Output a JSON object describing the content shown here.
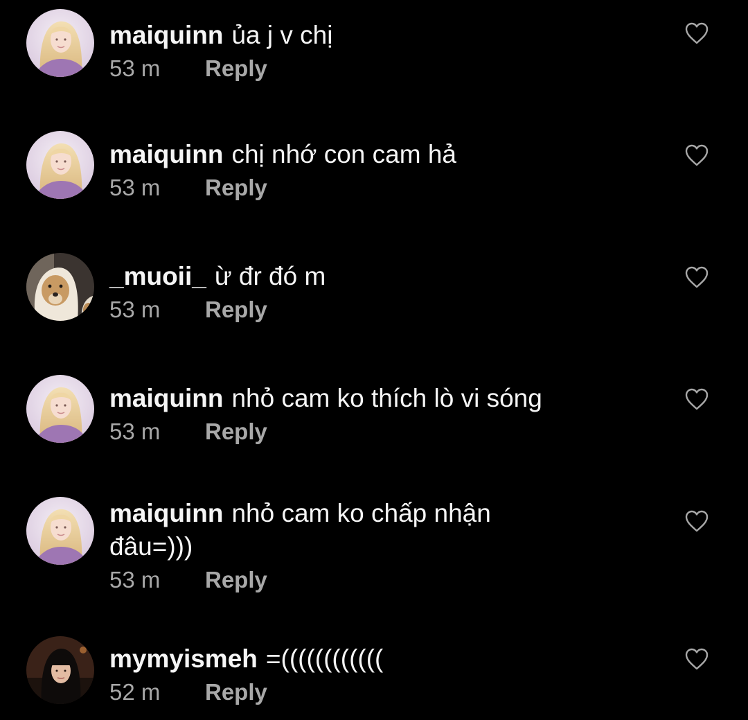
{
  "comments": [
    {
      "username": "maiquinn",
      "text": "ủa j v chị",
      "time": "53 m",
      "reply_label": "Reply",
      "avatar": "blonde-girl-avatar"
    },
    {
      "username": "maiquinn",
      "text": "chị nhớ con cam hả",
      "time": "53 m",
      "reply_label": "Reply",
      "avatar": "blonde-girl-avatar"
    },
    {
      "username": "_muoii_",
      "text": "ừ đr đó m",
      "time": "53 m",
      "reply_label": "Reply",
      "avatar": "dog-avatar"
    },
    {
      "username": "maiquinn",
      "text": "nhỏ cam ko thích lò vi sóng",
      "time": "53 m",
      "reply_label": "Reply",
      "avatar": "blonde-girl-avatar"
    },
    {
      "username": "maiquinn",
      "text": "nhỏ cam ko chấp nhận",
      "text_line2": "đâu=)))",
      "time": "53 m",
      "reply_label": "Reply",
      "avatar": "blonde-girl-avatar"
    },
    {
      "username": "mymyismeh",
      "text": "=((((((((((((",
      "time": "52 m",
      "reply_label": "Reply",
      "avatar": "dark-hair-girl-avatar"
    }
  ],
  "icons": {
    "like": "heart-outline-icon"
  },
  "colors": {
    "background": "#000000",
    "text": "#f5f5f5",
    "meta": "#a8a8a8"
  }
}
